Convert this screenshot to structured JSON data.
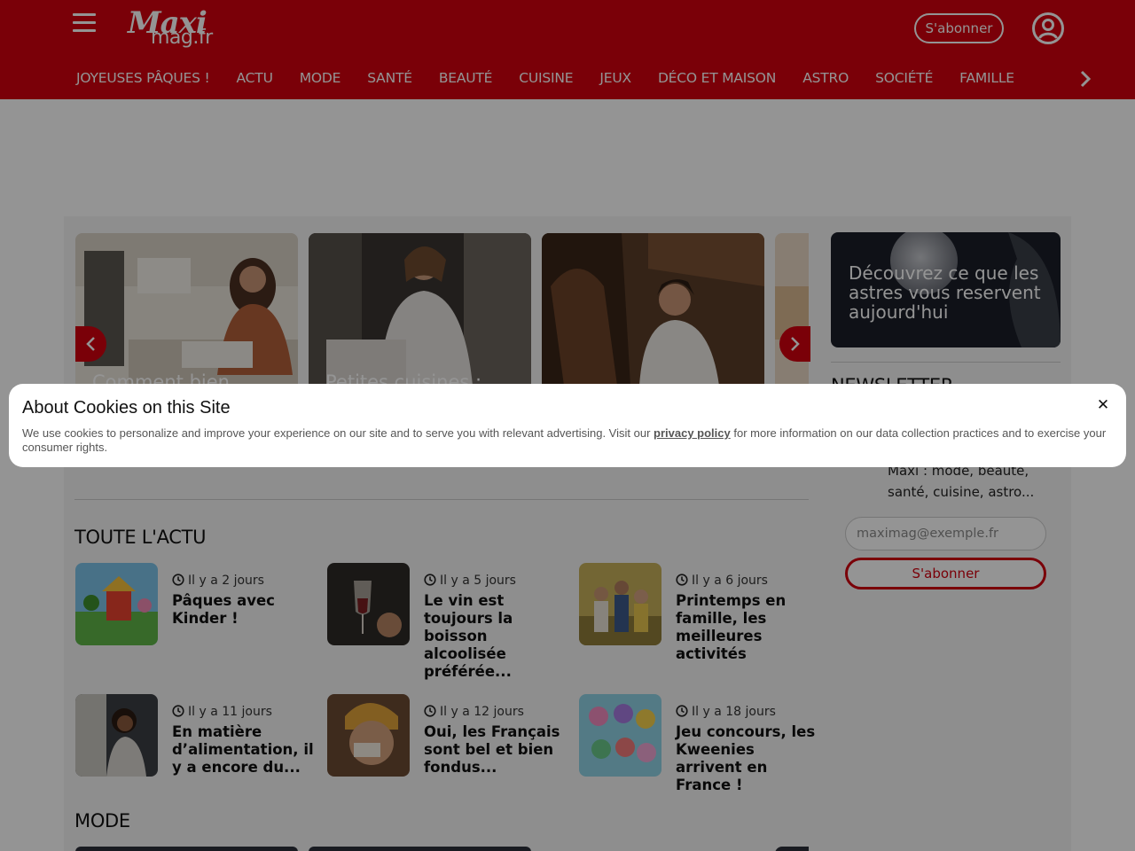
{
  "brand": {
    "logo_line1": "Maxi",
    "logo_line2": "mag.fr",
    "accent_color": "#d2000f"
  },
  "header": {
    "menu_icon": "hamburger-icon",
    "subscribe_label": "S'abonner",
    "account_icon": "user-account-icon",
    "nav_next_icon": "chevron-right-icon",
    "nav": [
      "JOYEUSES PÂQUES !",
      "ACTU",
      "MODE",
      "SANTÉ",
      "BEAUTÉ",
      "CUISINE",
      "JEUX",
      "DÉCO ET MAISON",
      "ASTRO",
      "SOCIÉTÉ",
      "FAMILLE"
    ]
  },
  "carousel": {
    "prev_icon": "chevron-left-icon",
    "next_icon": "chevron-right-icon",
    "cards": [
      {
        "caption": "Comment bien"
      },
      {
        "caption": "Petites cuisines :"
      },
      {
        "caption": ""
      },
      {
        "caption": ""
      }
    ]
  },
  "actu": {
    "title": "TOUTE L'ACTU",
    "clock_icon": "clock-icon",
    "articles": [
      {
        "time": "Il y a 2 jours",
        "title": "Pâques avec Kinder !"
      },
      {
        "time": "Il y a 5 jours",
        "title": "Le vin est toujours la boisson alcoolisée préférée..."
      },
      {
        "time": "Il y a 6 jours",
        "title": "Printemps en famille, les meilleures activités"
      },
      {
        "time": "Il y a 11 jours",
        "title": "En matière d’alimentation, il y a encore du..."
      },
      {
        "time": "Il y a 12 jours",
        "title": "Oui, les Français sont bel et bien fondus..."
      },
      {
        "time": "Il y a 18 jours",
        "title": "Jeu concours, les Kweenies arrivent en France !"
      }
    ]
  },
  "mode": {
    "title": "MODE"
  },
  "sidebar": {
    "promo_text": "Découvrez ce que les astres vous reservent aujourd'hui",
    "newsletter_title": "NEWSLETTER",
    "newsletter_desc": "Maxi : mode, beauté, santé, cuisine, astro...",
    "email_placeholder": "maximag@exemple.fr",
    "subscribe_label": "S'abonner"
  },
  "cookie": {
    "title": "About Cookies on this Site",
    "text_before": "We use cookies to personalize and improve your experience on our site and to serve you with relevant advertising. Visit our ",
    "link": "privacy policy",
    "text_after": " for more information on our data collection practices and to exercise your consumer rights.",
    "close": "✕",
    "close_icon": "close-icon"
  }
}
